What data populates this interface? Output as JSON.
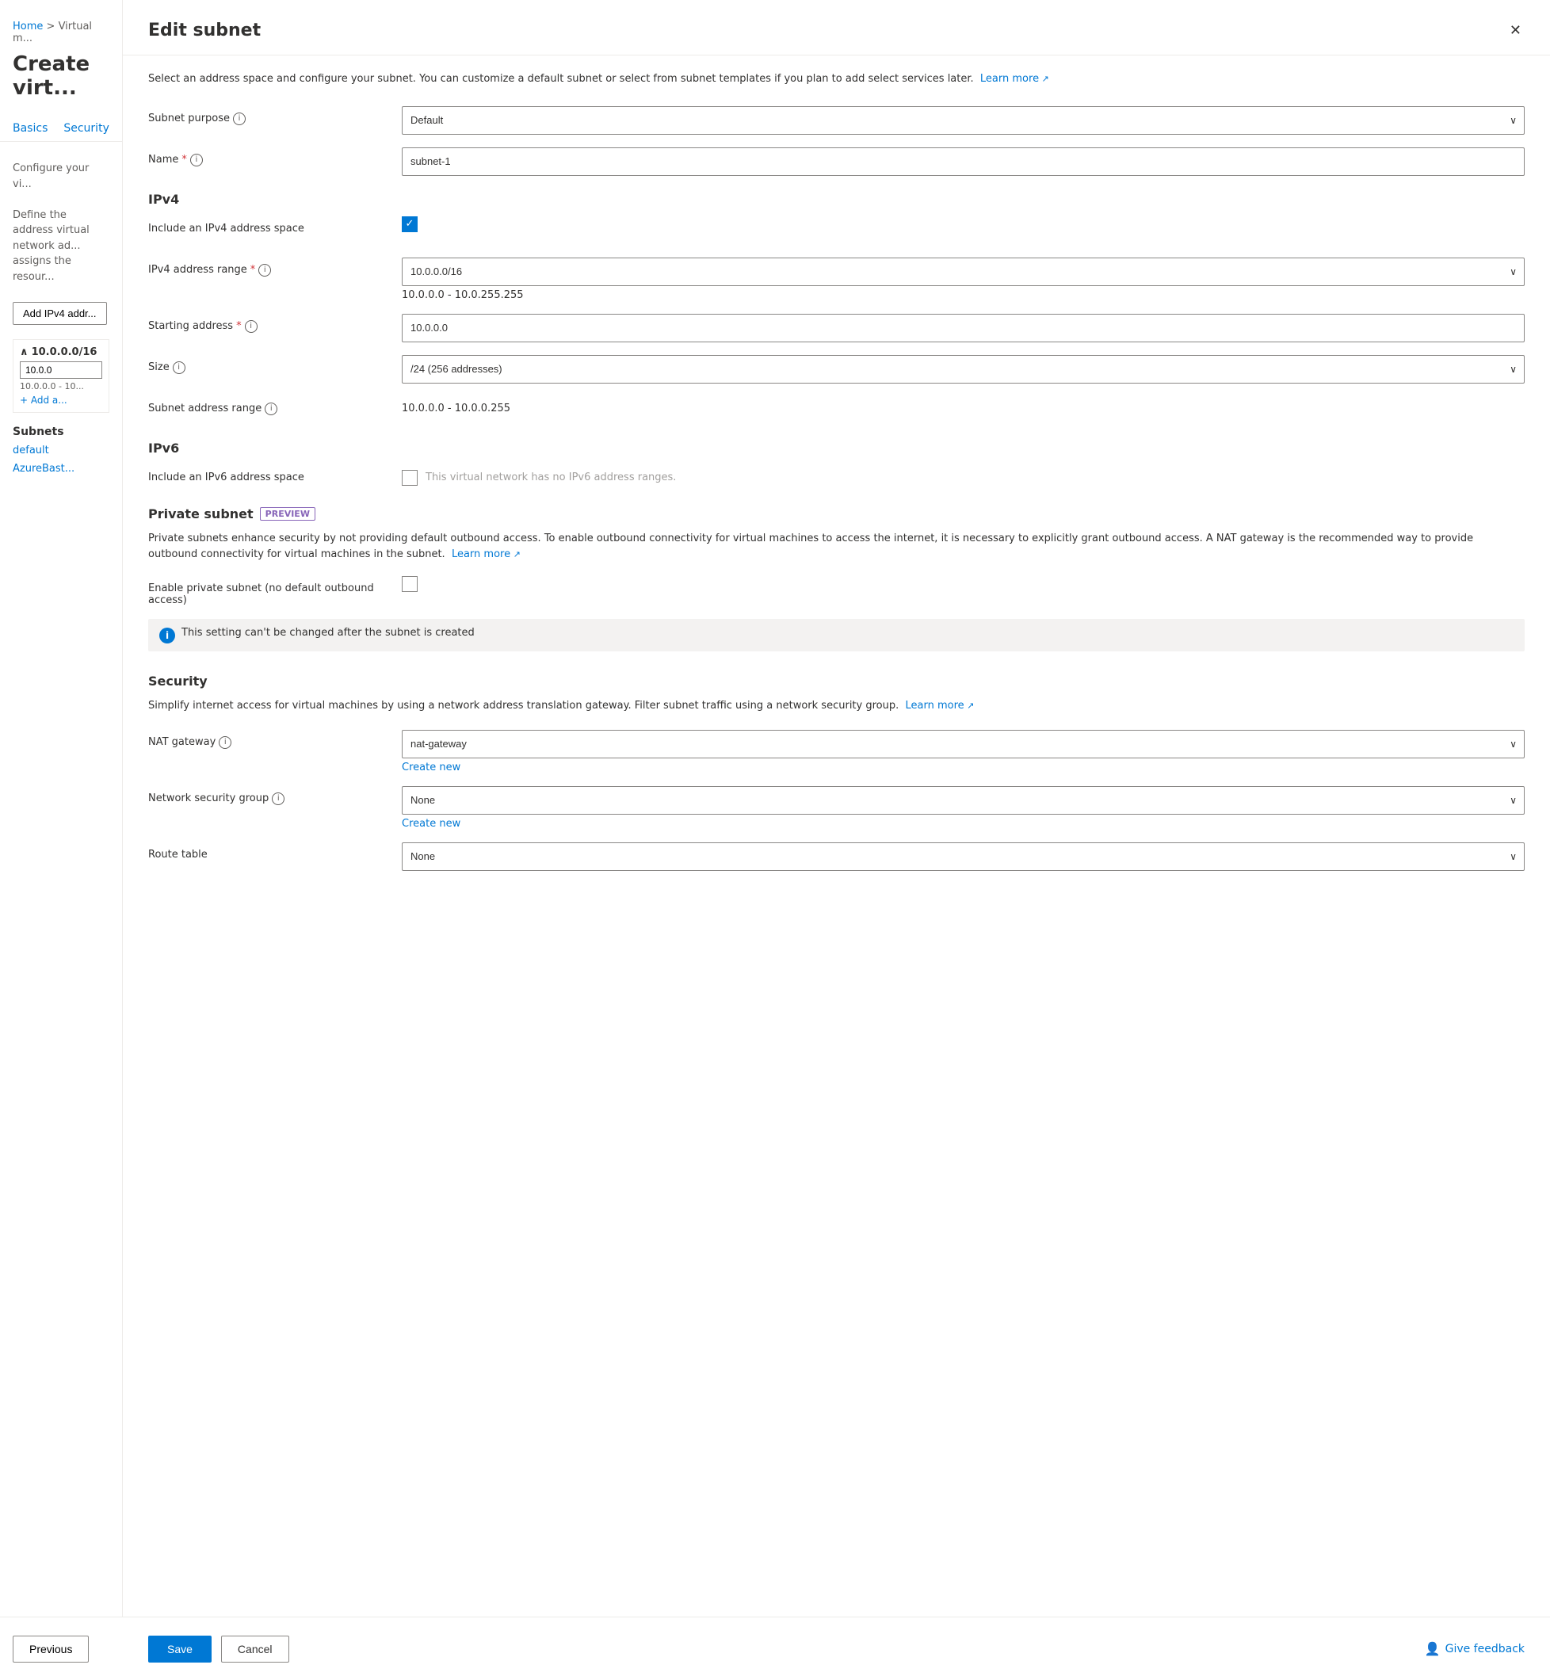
{
  "breadcrumb": {
    "home": "Home",
    "separator": ">",
    "current": "Virtual m..."
  },
  "page_title": "Create virt...",
  "nav_tabs": [
    "Basics",
    "Security"
  ],
  "left_content": {
    "configure": "Configure your vi...",
    "define": "Define the address\nvirtual network ad...\nassigns the resour..."
  },
  "add_button": "Add IPv4 addr...",
  "ip_block": {
    "header": "10.0.0.0/16",
    "input_value": "10.0.0",
    "range": "10.0.0.0 - 10...",
    "add_link": "+ Add a..."
  },
  "subnets": {
    "label": "Subnets",
    "items": [
      "default",
      "AzureBast..."
    ]
  },
  "panel": {
    "title": "Edit subnet",
    "description": "Select an address space and configure your subnet. You can customize a default subnet or select from subnet templates if you plan to add select services later.",
    "learn_more": "Learn more",
    "sections": {
      "ipv4": {
        "title": "IPv4",
        "fields": {
          "subnet_purpose": {
            "label": "Subnet purpose",
            "value": "Default"
          },
          "name": {
            "label": "Name",
            "required": true,
            "value": "subnet-1"
          },
          "include_ipv4": {
            "label": "Include an IPv4 address space",
            "checked": true
          },
          "ipv4_range": {
            "label": "IPv4 address range",
            "required": true,
            "value": "10.0.0.0/16",
            "sub_text": "10.0.0.0 - 10.0.255.255"
          },
          "starting_address": {
            "label": "Starting address",
            "required": true,
            "value": "10.0.0.0"
          },
          "size": {
            "label": "Size",
            "value": "/24 (256 addresses)"
          },
          "subnet_address_range": {
            "label": "Subnet address range",
            "value": "10.0.0.0 - 10.0.0.255"
          }
        }
      },
      "ipv6": {
        "title": "IPv6",
        "fields": {
          "include_ipv6": {
            "label": "Include an IPv6 address space",
            "placeholder": "This virtual network has no IPv6 address ranges."
          }
        }
      },
      "private_subnet": {
        "title": "Private subnet",
        "badge": "PREVIEW",
        "description": "Private subnets enhance security by not providing default outbound access. To enable outbound connectivity for virtual machines to access the internet, it is necessary to explicitly grant outbound access. A NAT gateway is the recommended way to provide outbound connectivity for virtual machines in the subnet.",
        "learn_more": "Learn more",
        "fields": {
          "enable_private": {
            "label": "Enable private subnet (no default outbound access)",
            "checked": false
          }
        },
        "info_note": "This setting can't be changed after the subnet is created"
      },
      "security": {
        "title": "Security",
        "description": "Simplify internet access for virtual machines by using a network address translation gateway. Filter subnet traffic using a network security group.",
        "learn_more": "Learn more",
        "fields": {
          "nat_gateway": {
            "label": "NAT gateway",
            "value": "nat-gateway",
            "create_new": "Create new"
          },
          "network_security_group": {
            "label": "Network security group",
            "value": "None",
            "create_new": "Create new"
          },
          "route_table": {
            "label": "Route table",
            "value": "None"
          }
        }
      }
    }
  },
  "footer": {
    "save": "Save",
    "cancel": "Cancel",
    "give_feedback": "Give feedback"
  },
  "bottom_nav": {
    "previous": "Previous"
  }
}
